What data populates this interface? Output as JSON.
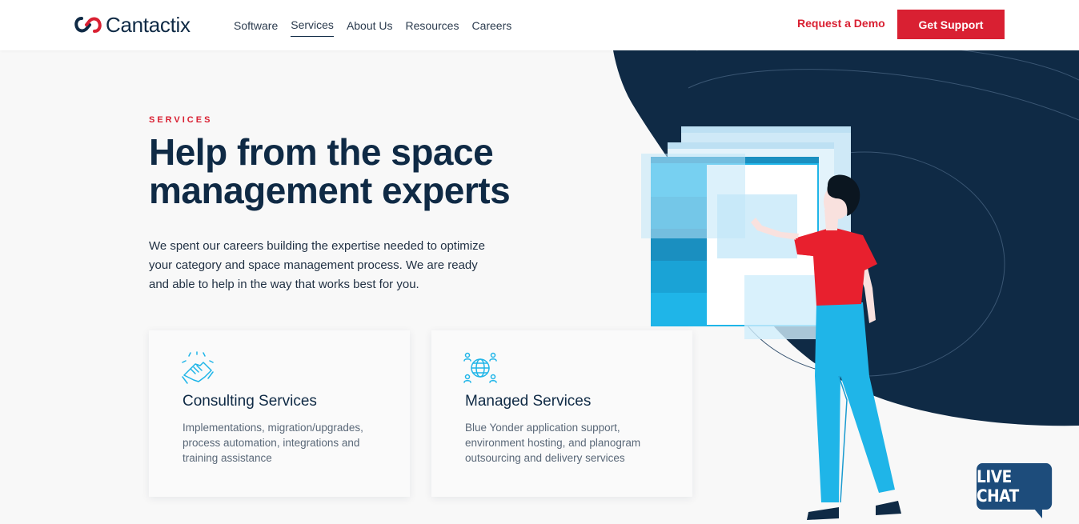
{
  "brand": {
    "name": "Cantactix"
  },
  "nav": {
    "items": [
      {
        "label": "Software",
        "active": false
      },
      {
        "label": "Services",
        "active": true
      },
      {
        "label": "About Us",
        "active": false
      },
      {
        "label": "Resources",
        "active": false
      },
      {
        "label": "Careers",
        "active": false
      }
    ],
    "request_demo": "Request a Demo",
    "get_support": "Get Support"
  },
  "hero": {
    "eyebrow": "SERVICES",
    "title": "Help from the space management experts",
    "description": "We spent our careers building the expertise needed to optimize your category and space management process. We are ready and able to help in the way that works best for you."
  },
  "cards": [
    {
      "icon": "handshake-icon",
      "title": "Consulting Services",
      "text": "Implementations, migration/upgrades, process automation, integrations and training assistance"
    },
    {
      "icon": "globe-network-icon",
      "title": "Managed Services",
      "text": "Blue Yonder application support, environment hosting, and planogram outsourcing and delivery services"
    }
  ],
  "live_chat": {
    "label": "LIVE CHAT"
  },
  "colors": {
    "accent": "#d92032",
    "navy": "#0f2a45",
    "sky": "#1fb5e8",
    "shirt": "#e8202e"
  }
}
